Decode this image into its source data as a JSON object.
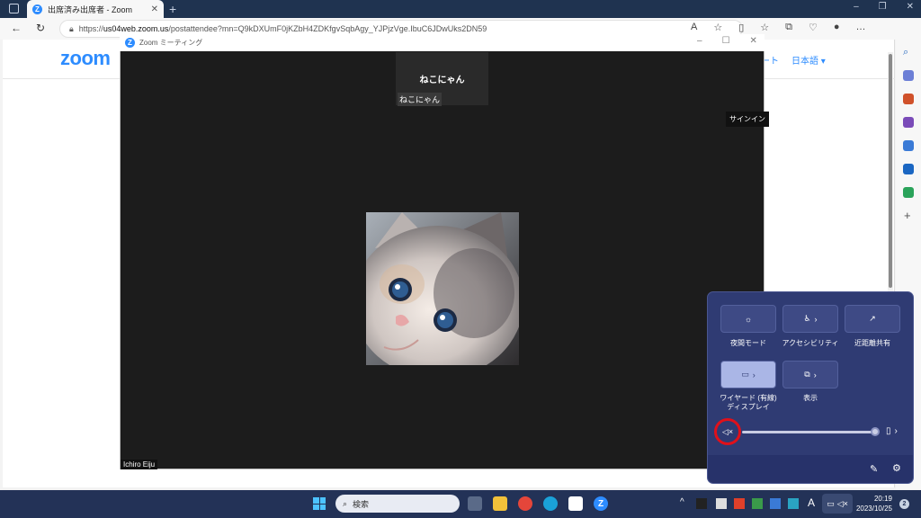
{
  "browser": {
    "tab_title": "出席済み出席者 - Zoom",
    "tab_close": "✕",
    "new_tab": "+",
    "url_prefix": "https://",
    "url_host": "us04web.zoom.us",
    "url_path": "/postattendee?mn=Q9kDXUmF0jKZbH4ZDKfgvSqbAgy_YJPjzVge.IbuC6JDwUks2DN59",
    "window_controls": [
      "–",
      "❐",
      "✕"
    ],
    "nav": {
      "back": "←",
      "reload": "↻"
    },
    "toolbar_icons": [
      "A",
      "☆",
      "▯",
      "☆",
      "⧉",
      "♡",
      "●",
      "…"
    ]
  },
  "page": {
    "brand": "zoom",
    "nav_link": "ート",
    "lang_link": "日本語 ▾"
  },
  "zoom_window": {
    "title": "Zoom ミーティング",
    "controls": [
      "–",
      "☐",
      "✕"
    ],
    "participant_tile_name": "ねこにゃん",
    "participant_tile_label": "ねこにゃん",
    "signin_label": "サインイン",
    "self_name": "Ichiro Eiju"
  },
  "quick_settings": {
    "buttons": [
      {
        "label": "夜間モード",
        "icon": "☼",
        "chevron": ""
      },
      {
        "label": "アクセシビリティ",
        "icon": "♿",
        "chevron": "›"
      },
      {
        "label": "近距離共有",
        "icon": "↗",
        "chevron": ""
      },
      {
        "label": "ワイヤード (有線) ディスプレイ",
        "icon": "▭",
        "chevron": "›",
        "active": true
      },
      {
        "label": "表示",
        "icon": "⧉",
        "chevron": "›"
      }
    ],
    "volume": {
      "muted": true,
      "level": 0.98,
      "mute_icon": "🔇",
      "output_icon": "▯",
      "output_chevron": "›"
    },
    "footer_icons": {
      "edit": "✎",
      "settings": "⚙"
    }
  },
  "taskbar": {
    "search_placeholder": "検索",
    "time": "20:19",
    "date": "2023/10/25",
    "notification_count": "2",
    "tray": [
      "^",
      "A"
    ]
  },
  "colors": {
    "accent": "#2d8cff",
    "taskbar": "#233257",
    "quick_settings": "#2f3b73",
    "mute_highlight": "#e0101a"
  }
}
